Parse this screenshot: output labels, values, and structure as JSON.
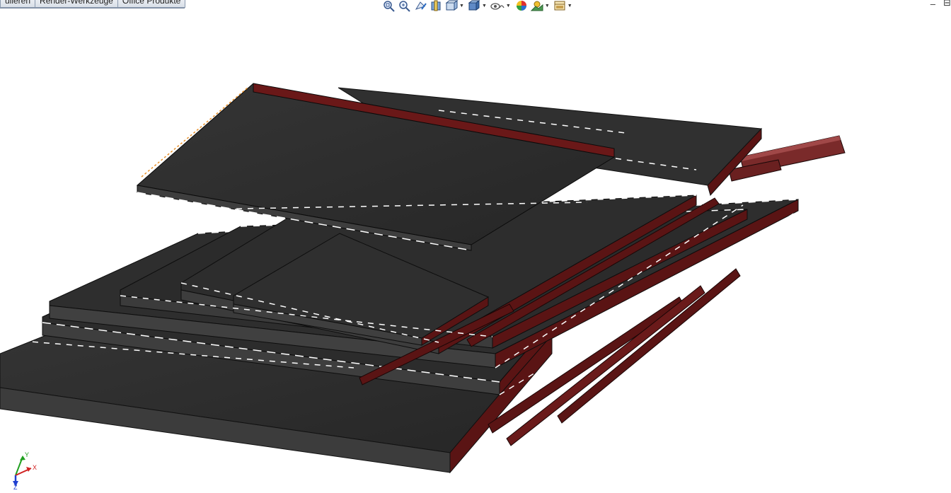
{
  "command_tabs": [
    {
      "label": "ulieren"
    },
    {
      "label": "Render-Werkzeuge"
    },
    {
      "label": "Office Produkte"
    }
  ],
  "view_toolbar": [
    {
      "icon": "zoom-to-fit-icon"
    },
    {
      "icon": "zoom-to-area-icon"
    },
    {
      "icon": "previous-view-icon"
    },
    {
      "icon": "section-view-icon"
    },
    {
      "icon": "view-orientation-icon",
      "dropdown": true
    },
    {
      "icon": "display-style-icon",
      "dropdown": true
    },
    {
      "icon": "hide-show-items-icon",
      "dropdown": true
    },
    {
      "icon": "edit-appearance-icon"
    },
    {
      "icon": "apply-scene-icon",
      "dropdown": true
    },
    {
      "icon": "view-settings-icon",
      "dropdown": true
    }
  ],
  "window_controls": {
    "minimize": "–",
    "restore": "⊟"
  },
  "triad": {
    "x_label": "X",
    "y_label": "Y",
    "z_label": "Z"
  },
  "colors": {
    "background": "#ffffff",
    "panel_top": "#2e2e2e",
    "panel_side": "#3c3c3c",
    "panel_edge": "#5a1414",
    "axis_x": "#d02020",
    "axis_y": "#20a020",
    "axis_z": "#2040d0"
  }
}
